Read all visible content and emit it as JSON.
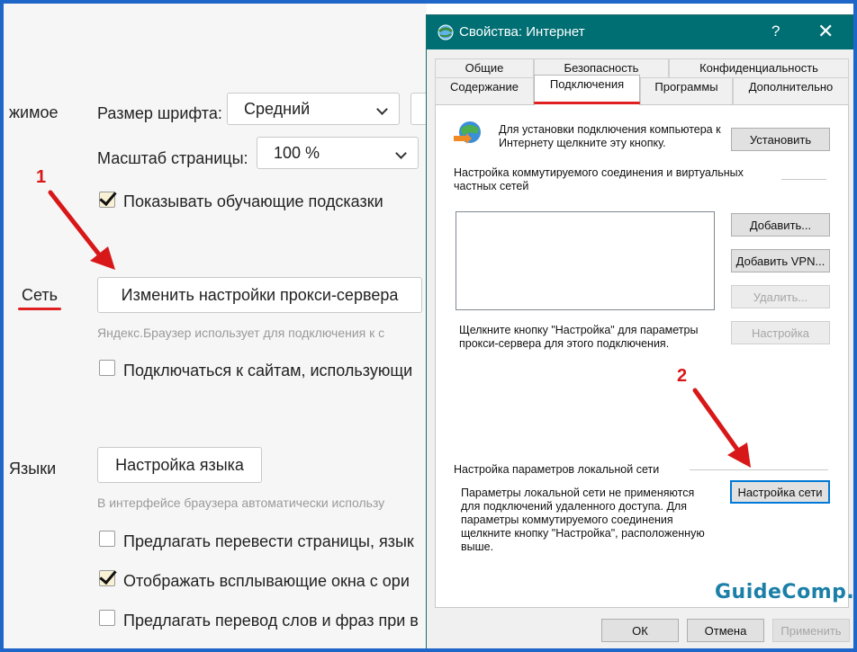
{
  "browser": {
    "section_partial": "жимое",
    "font_size_label": "Размер шрифта:",
    "font_size_value": "Средний",
    "page_zoom_label": "Масштаб страницы:",
    "page_zoom_value": "100 %",
    "show_hints_label": "Показывать обучающие подсказки",
    "network_label": "Сеть",
    "proxy_button": "Изменить настройки прокси-сервера",
    "proxy_hint": "Яндекс.Браузер использует для подключения к с",
    "connect_sites_label": "Подключаться к сайтам, использующи",
    "languages_label": "Языки",
    "language_button": "Настройка языка",
    "language_hint": "В интерфейсе браузера автоматически использу",
    "translate_pages_label": "Предлагать перевести страницы, язык",
    "show_popups_label": "Отображать всплывающие окна с ори",
    "translate_words_label": "Предлагать перевод слов и фраз при в"
  },
  "annotations": {
    "one": "1",
    "two": "2",
    "color": "#d81818"
  },
  "dialog": {
    "title": "Свойства: Интернет",
    "help": "?",
    "close": "✕",
    "tabs_row1": [
      "Общие",
      "Безопасность",
      "Конфиденциальность"
    ],
    "tabs_row2": [
      "Содержание",
      "Подключения",
      "Программы",
      "Дополнительно"
    ],
    "setup_text": "Для установки подключения компьютера к Интернету щелкните эту кнопку.",
    "setup_button": "Установить",
    "dialup_header": "Настройка коммутируемого соединения и виртуальных частных сетей",
    "add_button": "Добавить...",
    "add_vpn_button": "Добавить VPN...",
    "remove_button": "Удалить...",
    "settings_hint": "Щелкните кнопку \"Настройка\" для параметры прокси-сервера для этого подключения.",
    "settings_button": "Настройка",
    "lan_header": "Настройка параметров локальной сети",
    "lan_text": "Параметры локальной сети не применяются для подключений удаленного доступа. Для параметры коммутируемого соединения щелкните кнопку \"Настройка\", расположенную выше.",
    "lan_button": "Настройка сети",
    "ok_button": "ОК",
    "cancel_button": "Отмена",
    "apply_button": "Применить"
  },
  "watermark": "GuideComp.ru",
  "colors": {
    "titlebar": "#006f74",
    "frame": "#1f66c9",
    "accent_red": "#e02020"
  }
}
